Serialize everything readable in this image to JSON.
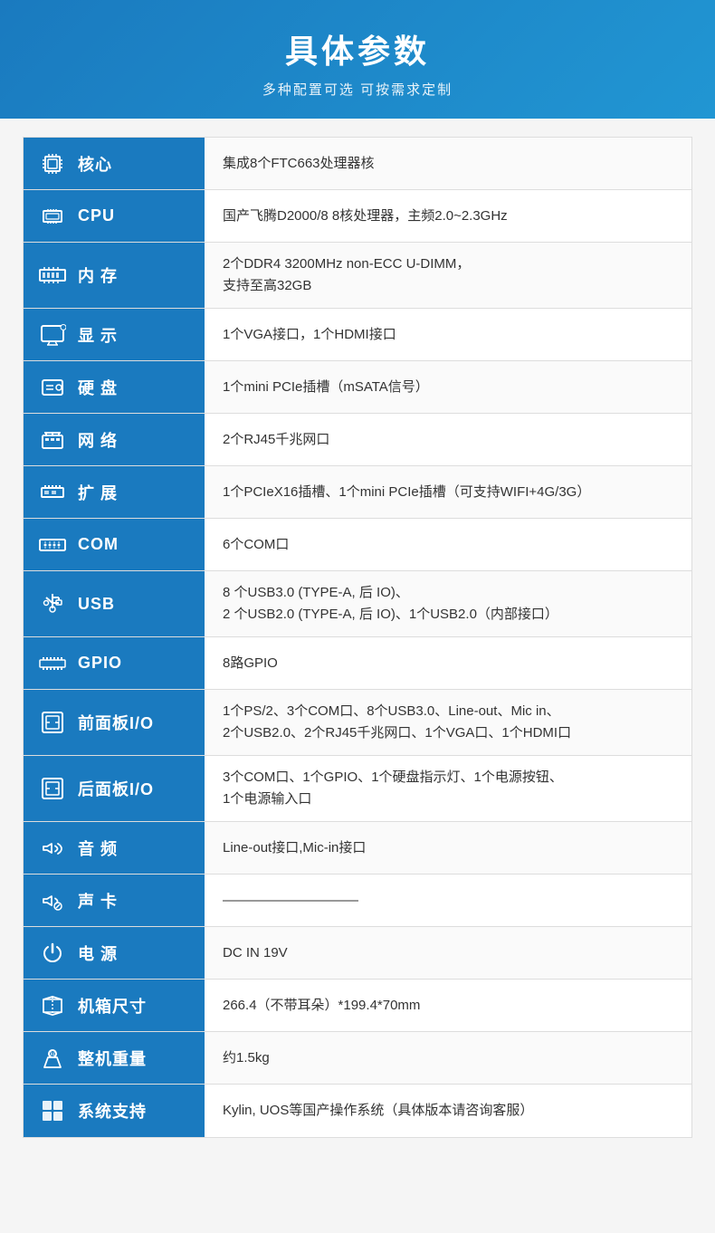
{
  "header": {
    "title": "具体参数",
    "subtitle": "多种配置可选 可按需求定制"
  },
  "rows": [
    {
      "id": "core",
      "icon": "chip",
      "label": "核心",
      "value": "集成8个FTC663处理器核"
    },
    {
      "id": "cpu",
      "icon": "cpu",
      "label": "CPU",
      "value": "国产飞腾D2000/8  8核处理器，主频2.0~2.3GHz"
    },
    {
      "id": "memory",
      "icon": "memory",
      "label": "内 存",
      "value": "2个DDR4 3200MHz non-ECC U-DIMM，\n支持至高32GB"
    },
    {
      "id": "display",
      "icon": "display",
      "label": "显 示",
      "value": "1个VGA接口，1个HDMI接口"
    },
    {
      "id": "storage",
      "icon": "hdd",
      "label": "硬 盘",
      "value": "1个mini PCIe插槽（mSATA信号）"
    },
    {
      "id": "network",
      "icon": "network",
      "label": "网 络",
      "value": "2个RJ45千兆网口"
    },
    {
      "id": "expansion",
      "icon": "expansion",
      "label": "扩 展",
      "value": "1个PCIeX16插槽、1个mini PCIe插槽（可支持WIFI+4G/3G）"
    },
    {
      "id": "com",
      "icon": "com",
      "label": "COM",
      "value": "6个COM口"
    },
    {
      "id": "usb",
      "icon": "usb",
      "label": "USB",
      "value": "8 个USB3.0 (TYPE-A, 后 IO)、\n2 个USB2.0 (TYPE-A, 后 IO)、1个USB2.0（内部接口）"
    },
    {
      "id": "gpio",
      "icon": "gpio",
      "label": "GPIO",
      "value": "8路GPIO"
    },
    {
      "id": "front-panel",
      "icon": "panel",
      "label": "前面板I/O",
      "value": "1个PS/2、3个COM口、8个USB3.0、Line-out、Mic in、\n2个USB2.0、2个RJ45千兆网口、1个VGA口、1个HDMI口"
    },
    {
      "id": "rear-panel",
      "icon": "panel",
      "label": "后面板I/O",
      "value": "3个COM口、1个GPIO、1个硬盘指示灯、1个电源按钮、\n1个电源输入口"
    },
    {
      "id": "audio",
      "icon": "audio",
      "label": "音 频",
      "value": "Line-out接口,Mic-in接口"
    },
    {
      "id": "soundcard",
      "icon": "soundcard",
      "label": "声 卡",
      "value": "——————————"
    },
    {
      "id": "power",
      "icon": "power",
      "label": "电 源",
      "value": "DC IN 19V"
    },
    {
      "id": "chassis",
      "icon": "chassis",
      "label": "机箱尺寸",
      "value": "266.4（不带耳朵）*199.4*70mm"
    },
    {
      "id": "weight",
      "icon": "weight",
      "label": "整机重量",
      "value": "约1.5kg"
    },
    {
      "id": "os",
      "icon": "os",
      "label": "系统支持",
      "value": "Kylin, UOS等国产操作系统（具体版本请咨询客服）"
    }
  ]
}
